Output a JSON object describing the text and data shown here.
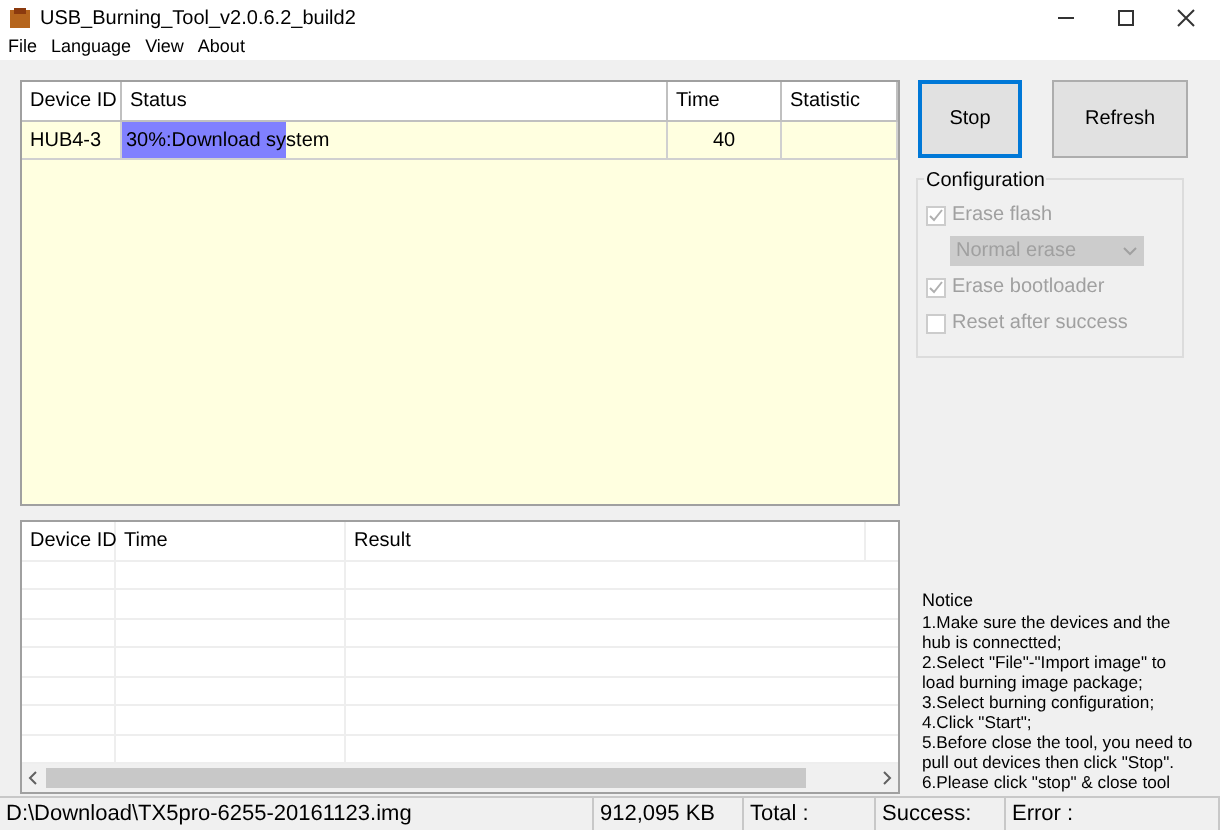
{
  "window": {
    "title": "USB_Burning_Tool_v2.0.6.2_build2"
  },
  "menu": [
    "File",
    "Language",
    "View",
    "About"
  ],
  "device_table": {
    "columns": [
      "Device ID",
      "Status",
      "Time",
      "Statistic"
    ],
    "rows": [
      {
        "device_id": "HUB4-3",
        "status": "30%:Download system",
        "level": 0.3,
        "time": "40",
        "statistic": ""
      }
    ]
  },
  "buttons": [
    {
      "label": "Stop",
      "focused": true
    },
    {
      "label": "Refresh",
      "focused": false
    }
  ],
  "configuration": {
    "title": "Configuration",
    "items": [
      {
        "kind": "checkbox",
        "label": "Erase flash",
        "checked": true,
        "disabled": true
      },
      {
        "kind": "select",
        "value": "Normal erase",
        "disabled": true
      },
      {
        "kind": "checkbox",
        "label": "Erase bootloader",
        "checked": true,
        "disabled": true
      },
      {
        "kind": "checkbox",
        "label": "Reset after success",
        "checked": false,
        "disabled": true
      }
    ]
  },
  "result_table": {
    "columns": [
      "Device ID",
      "Time",
      "Result"
    ]
  },
  "notice": {
    "title": "Notice",
    "lines": [
      "1.Make sure the devices and the hub is connectted;",
      "2.Select \"File\"-\"Import image\" to load burning image package;",
      "3.Select burning configuration;",
      "4.Click \"Start\";",
      "5.Before close the tool, you need to pull out devices then click \"Stop\".",
      "6.Please click \"stop\" & close tool"
    ]
  },
  "status_bar": [
    "D:\\Download\\TX5pro-6255-20161123.img",
    "912,095 KB",
    "Total :",
    "Success:",
    "Error :"
  ]
}
